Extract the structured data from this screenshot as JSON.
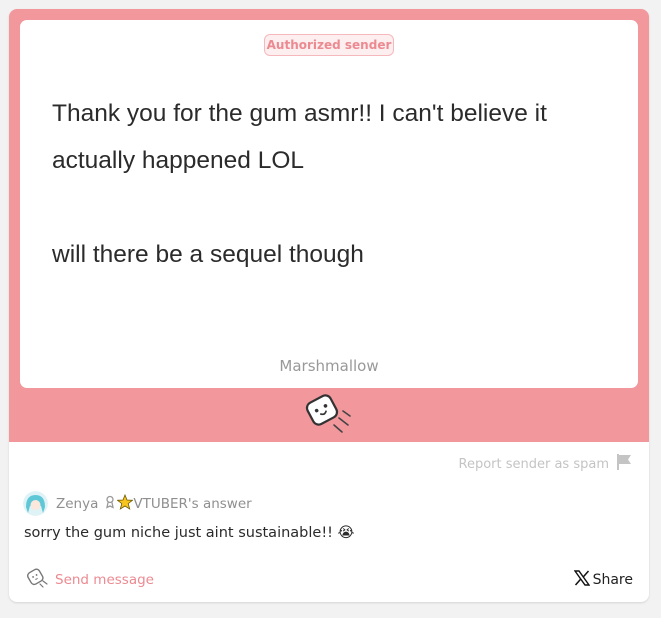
{
  "card": {
    "badge": "Authorized sender",
    "message_lines": [
      "Thank you for the gum asmr!! I can't believe it",
      "actually happened LOL",
      "",
      "will there be a sequel though"
    ],
    "brand": "Marshmallow"
  },
  "actions": {
    "report_label": "Report sender as spam",
    "send_label": "Send message",
    "share_label": "Share"
  },
  "answer": {
    "author": "Zenya",
    "author_suffix": "VTUBER's answer",
    "text": "sorry the gum niche just aint sustainable!! 😭"
  },
  "colors": {
    "accent": "#f2979c",
    "badge_text": "#ec8a91"
  },
  "icons": {
    "mascot": "marshmallow-mascot-icon",
    "report": "flag-icon",
    "send": "marshmallow-send-icon",
    "share": "x-logo-icon"
  }
}
